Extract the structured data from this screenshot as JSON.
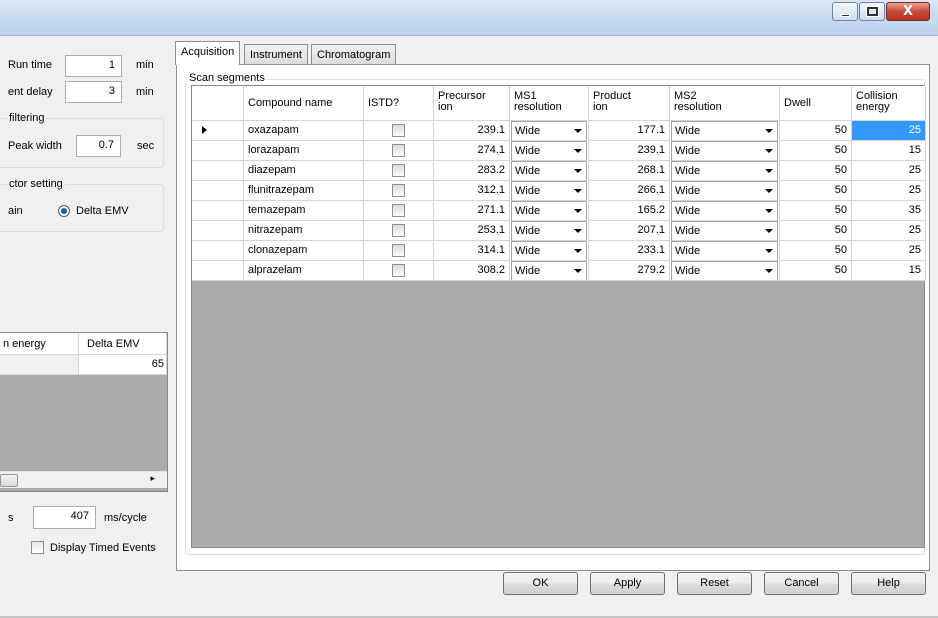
{
  "left": {
    "run_time_label": "Run time",
    "run_time_value": "1",
    "run_time_unit": "min",
    "solvent_delay_label": "ent delay",
    "solvent_delay_value": "3",
    "solvent_delay_unit": "min",
    "filtering_group": "filtering",
    "peak_width_label": "Peak width",
    "peak_width_value": "0.7",
    "peak_width_unit": "sec",
    "detector_group": "ctor setting",
    "gain_label": "ain",
    "delta_emv_label": "Delta EMV",
    "grid": {
      "headers": [
        "n energy",
        "Delta EMV"
      ],
      "row": [
        "",
        "65"
      ]
    },
    "cycle_label": "s",
    "cycle_value": "407",
    "cycle_unit": "ms/cycle",
    "display_timed_events_label": "Display Timed Events"
  },
  "tabs": [
    "Acquisition",
    "Instrument",
    "Chromatogram"
  ],
  "scan_segments_title": "Scan segments",
  "table": {
    "headers": [
      {
        "l1": "Compound name",
        "l2": ""
      },
      {
        "l1": "ISTD?",
        "l2": ""
      },
      {
        "l1": "Precursor",
        "l2": "ion"
      },
      {
        "l1": "MS1",
        "l2": "resolution"
      },
      {
        "l1": "Product",
        "l2": "ion"
      },
      {
        "l1": "MS2",
        "l2": "resolution"
      },
      {
        "l1": "Dwell",
        "l2": ""
      },
      {
        "l1": "Collision",
        "l2": "energy"
      }
    ],
    "rows": [
      {
        "name": "oxazapam",
        "istd": false,
        "precursor": "239.1",
        "ms1": "Wide",
        "product": "177.1",
        "ms2": "Wide",
        "dwell": "50",
        "ce": "25"
      },
      {
        "name": "lorazapam",
        "istd": false,
        "precursor": "274.1",
        "ms1": "Wide",
        "product": "239.1",
        "ms2": "Wide",
        "dwell": "50",
        "ce": "15"
      },
      {
        "name": "diazepam",
        "istd": false,
        "precursor": "283.2",
        "ms1": "Wide",
        "product": "268.1",
        "ms2": "Wide",
        "dwell": "50",
        "ce": "25"
      },
      {
        "name": "flunitrazepam",
        "istd": false,
        "precursor": "312.1",
        "ms1": "Wide",
        "product": "266.1",
        "ms2": "Wide",
        "dwell": "50",
        "ce": "25"
      },
      {
        "name": "temazepam",
        "istd": false,
        "precursor": "271.1",
        "ms1": "Wide",
        "product": "165.2",
        "ms2": "Wide",
        "dwell": "50",
        "ce": "35"
      },
      {
        "name": "nitrazepam",
        "istd": false,
        "precursor": "253.1",
        "ms1": "Wide",
        "product": "207.1",
        "ms2": "Wide",
        "dwell": "50",
        "ce": "25"
      },
      {
        "name": "clonazepam",
        "istd": false,
        "precursor": "314.1",
        "ms1": "Wide",
        "product": "233.1",
        "ms2": "Wide",
        "dwell": "50",
        "ce": "25"
      },
      {
        "name": "alprazelam",
        "istd": false,
        "precursor": "308.2",
        "ms1": "Wide",
        "product": "279.2",
        "ms2": "Wide",
        "dwell": "50",
        "ce": "15"
      }
    ]
  },
  "buttons": {
    "ok": "OK",
    "apply": "Apply",
    "reset": "Reset",
    "cancel": "Cancel",
    "help": "Help"
  },
  "window_buttons": {
    "close_glyph": "X"
  },
  "colors": {
    "selection": "#3399ff",
    "titlebar": "#c7daf0",
    "close": "#c74a3a"
  }
}
